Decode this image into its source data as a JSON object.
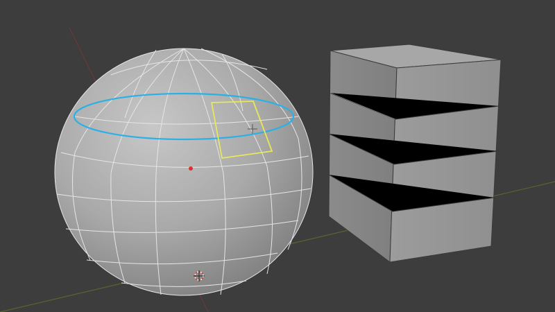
{
  "viewport": {
    "background": "#3d3d3d",
    "objects": [
      {
        "name": "UV Sphere",
        "type": "mesh",
        "mode": "edit"
      },
      {
        "name": "Cube",
        "type": "mesh",
        "mode": "object"
      }
    ],
    "selection": {
      "face": "quad",
      "edge_loop": "horizontal"
    }
  },
  "colors": {
    "mesh_face": "#9a9a9a",
    "mesh_wire": "#e6e6e6",
    "selected_face": "#e8e85a",
    "selected_loop": "#2bb0e6",
    "origin_dot": "#e0302c",
    "axis_x": "#7a3a3a",
    "axis_y": "#5d6e2c",
    "cube_edge": "#3a3a3a"
  },
  "icons": [
    "3d-cursor-icon",
    "object-origin-icon",
    "median-point-icon"
  ]
}
